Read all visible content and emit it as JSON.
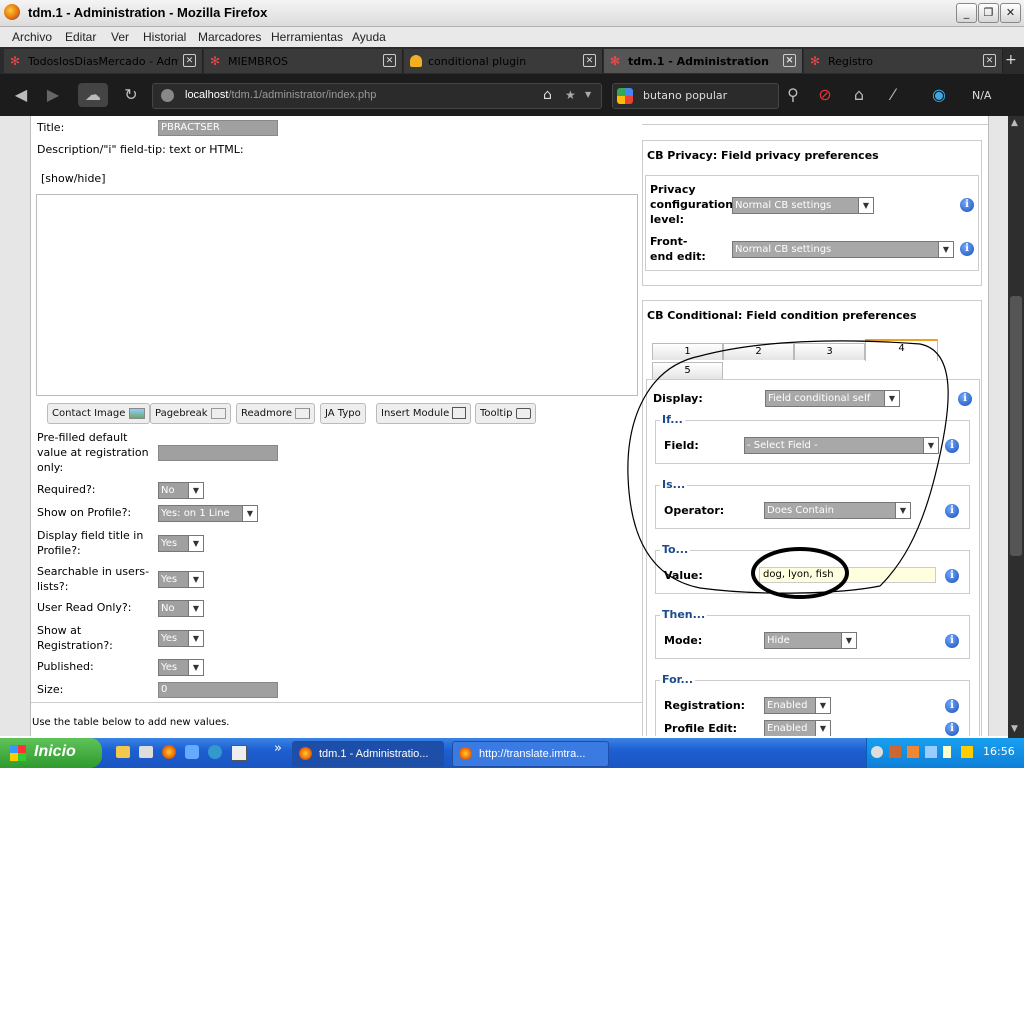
{
  "window": {
    "title": "tdm.1 - Administration - Mozilla Firefox"
  },
  "menu": [
    "Archivo",
    "Editar",
    "Ver",
    "Historial",
    "Marcadores",
    "Herramientas",
    "Ayuda"
  ],
  "tabs": [
    {
      "label": "TodoslosDiasMercado - Admi..."
    },
    {
      "label": "MIEMBROS"
    },
    {
      "label": "conditional plugin"
    },
    {
      "label": "tdm.1 - Administration"
    },
    {
      "label": "Registro"
    }
  ],
  "nav": {
    "url_host": "localhost",
    "url_path": "/tdm.1/administrator/index.php",
    "search_value": "butano popular",
    "na_label": "N/A"
  },
  "left": {
    "title_label": "Title:",
    "title_value": "PBRACTSER",
    "description_label": "Description/\"i\" field-tip: text or HTML:",
    "showhide": "[show/hide]",
    "editor_buttons": [
      "Contact Image",
      "Pagebreak",
      "Readmore",
      "JA Typo",
      "Insert Module",
      "Tooltip"
    ],
    "prefilled_label": "Pre-filled default value at registration only:",
    "required_label": "Required?:",
    "required_value": "No",
    "show_profile_label": "Show on Profile?:",
    "show_profile_value": "Yes: on 1 Line",
    "display_title_label": "Display field title in Profile?:",
    "display_title_value": "Yes",
    "searchable_label": "Searchable in users-lists?:",
    "searchable_value": "Yes",
    "readonly_label": "User Read Only?:",
    "readonly_value": "No",
    "show_reg_label": "Show at Registration?:",
    "show_reg_value": "Yes",
    "published_label": "Published:",
    "published_value": "Yes",
    "size_label": "Size:",
    "size_value": "0",
    "footer_text": "Use the table below to add new values."
  },
  "right": {
    "privacy_title": "CB Privacy: Field privacy preferences",
    "privacy_level_label": "Privacy configuration level:",
    "privacy_level_value": "Normal CB settings",
    "frontend_label": "Front-end edit:",
    "frontend_value": "Normal CB settings",
    "conditional_title": "CB Conditional: Field condition preferences",
    "cond_tabs": [
      "1",
      "2",
      "3",
      "4",
      "5"
    ],
    "display_label": "Display:",
    "display_value": "Field conditional self",
    "if_legend": "If...",
    "field_label": "Field:",
    "field_value": "- Select Field -",
    "is_legend": "Is...",
    "operator_label": "Operator:",
    "operator_value": "Does Contain",
    "to_legend": "To...",
    "value_label": "Value:",
    "value_value": "dog, lyon, fish",
    "then_legend": "Then...",
    "mode_label": "Mode:",
    "mode_value": "Hide",
    "for_legend": "For...",
    "registration_label": "Registration:",
    "registration_value": "Enabled",
    "profile_edit_label": "Profile Edit:",
    "profile_edit_value": "Enabled"
  },
  "taskbar": {
    "start": "Inicio",
    "chevron": "»",
    "items": [
      "tdm.1 - Administratio...",
      "http://translate.imtra..."
    ],
    "clock": "16:56"
  }
}
